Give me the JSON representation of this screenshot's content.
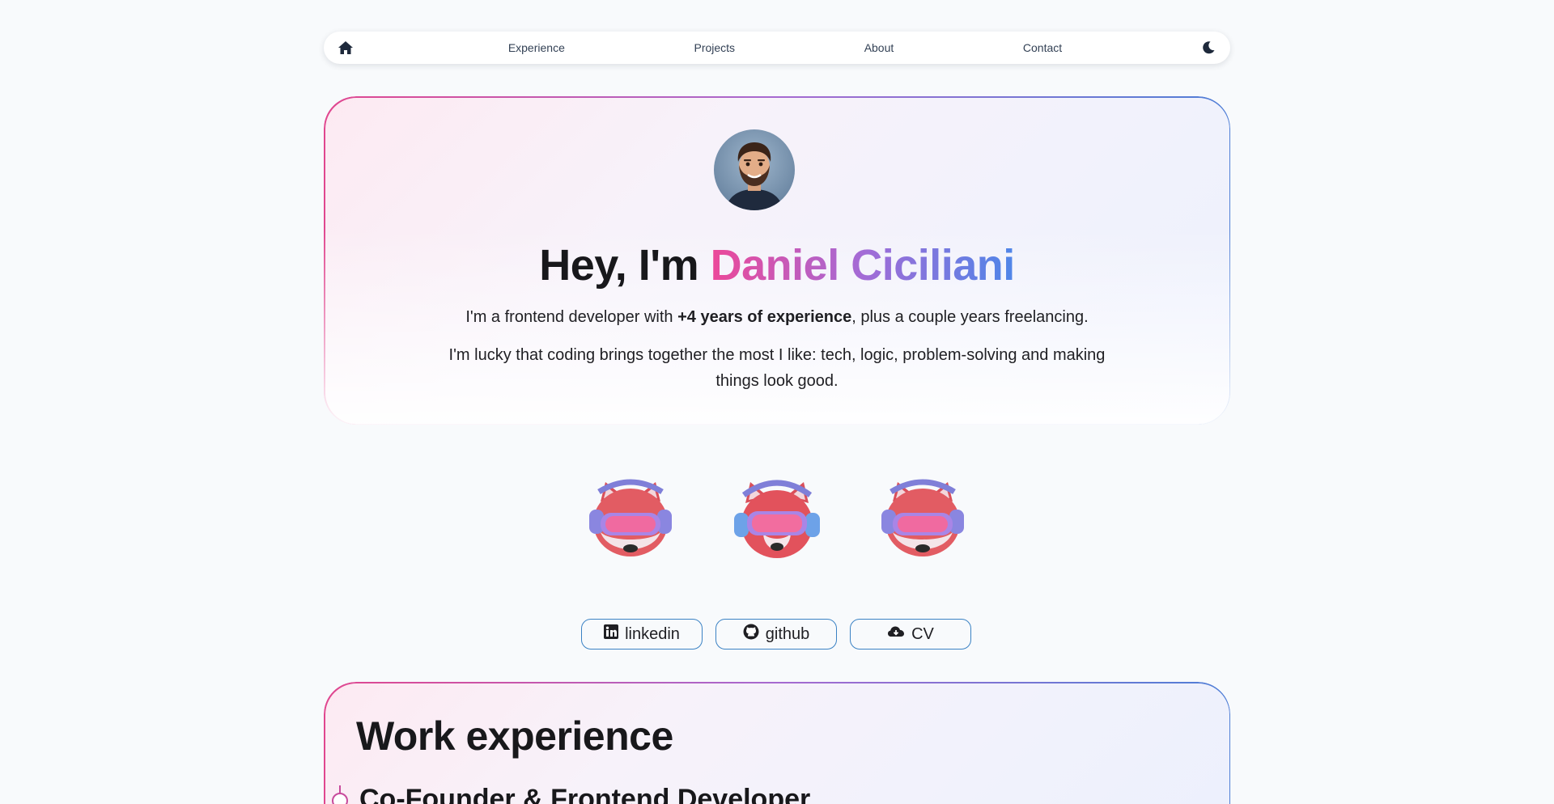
{
  "nav": {
    "home_icon": "home-icon",
    "links": [
      "Experience",
      "Projects",
      "About",
      "Contact"
    ],
    "theme_icon": "moon-icon"
  },
  "hero": {
    "greeting": "Hey, I'm ",
    "name": "Daniel Ciciliani",
    "p1_before": "I'm a frontend developer with ",
    "p1_bold": "+4 years of experience",
    "p1_after": ", plus a couple years freelancing.",
    "p2": "I'm lucky that coding brings together the most I like: tech, logic, problem-solving and making things look good."
  },
  "socials": [
    {
      "label": "linkedin",
      "icon": "linkedin-icon"
    },
    {
      "label": "github",
      "icon": "github-icon"
    },
    {
      "label": "CV",
      "icon": "cloud-download-icon"
    }
  ],
  "work": {
    "title": "Work experience",
    "first_role": "Co-Founder & Frontend Developer"
  },
  "colors": {
    "accent_pink": "#ec4899",
    "accent_purple": "#a36bd6",
    "accent_blue": "#4f86e8",
    "button_border": "#3b82c4"
  }
}
